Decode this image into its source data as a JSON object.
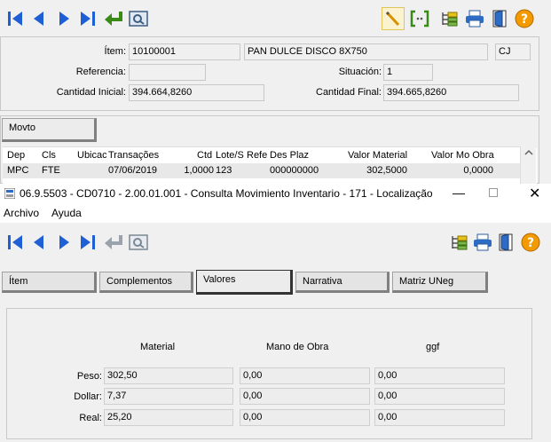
{
  "top": {
    "item_label": "Ítem:",
    "item_code": "10100001",
    "item_desc": "PAN DULCE DISCO 8X750",
    "item_unit": "CJ",
    "ref_label": "Referencia:",
    "ref_value": "",
    "situacion_label": "Situación:",
    "situacion_value": "1",
    "cant_inicial_label": "Cantidad Inicial:",
    "cant_inicial_value": "394.664,8260",
    "cant_final_label": "Cantidad Final:",
    "cant_final_value": "394.665,8260",
    "movto_tab": "Movto",
    "columns": [
      "Dep",
      "Cls",
      "Ubicac",
      "Transações",
      "Ctd",
      "Lote/S",
      "Refe",
      "Des Plaz",
      "Valor Material",
      "Valor Mo Obra"
    ],
    "row": [
      "MPC",
      "FTE",
      "",
      "07/06/2019",
      "1,0000",
      "123",
      "",
      "000000000",
      "302,5000",
      "0,0000"
    ]
  },
  "window": {
    "title": "06.9.5503 - CD0710 - 2.00.01.001 - Consulta Movimiento Inventario - 171 - Localização ...",
    "menu": [
      "Archivo",
      "Ayuda"
    ]
  },
  "tabs": [
    "Ítem",
    "Complementos",
    "Valores",
    "Narrativa",
    "Matriz UNeg"
  ],
  "valores": {
    "col_material": "Material",
    "col_mano_obra": "Mano de Obra",
    "col_ggf": "ggf",
    "rows": [
      {
        "label": "Peso:",
        "material": "302,50",
        "mano": "0,00",
        "ggf": "0,00"
      },
      {
        "label": "Dollar:",
        "material": "7,37",
        "mano": "0,00",
        "ggf": "0,00"
      },
      {
        "label": "Real:",
        "material": "25,20",
        "mano": "0,00",
        "ggf": "0,00"
      }
    ]
  },
  "colors": {
    "nav_blue": "#1f5fd6",
    "check_green": "#3a8a18",
    "help_orange": "#f29a00"
  }
}
